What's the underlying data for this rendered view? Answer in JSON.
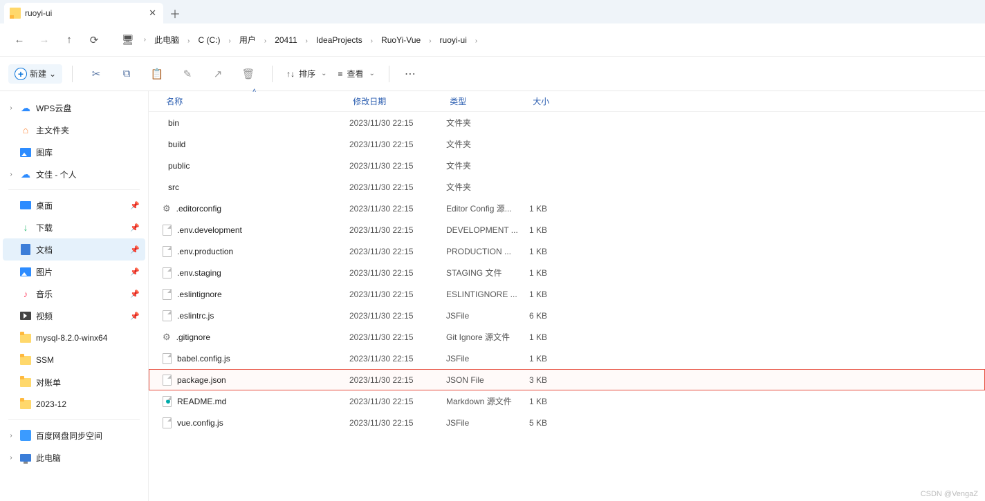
{
  "tab": {
    "title": "ruoyi-ui"
  },
  "breadcrumbs": [
    "此电脑",
    "C (C:)",
    "用户",
    "20411",
    "IdeaProjects",
    "RuoYi-Vue",
    "ruoyi-ui"
  ],
  "toolbar": {
    "new_label": "新建",
    "sort_label": "排序",
    "view_label": "查看"
  },
  "sidebar": {
    "group1": [
      {
        "label": "WPS云盘",
        "icon": "cloud",
        "exp": true
      },
      {
        "label": "主文件夹",
        "icon": "home",
        "exp": false
      },
      {
        "label": "图库",
        "icon": "pic",
        "exp": false
      },
      {
        "label": "文佳 - 个人",
        "icon": "cloud",
        "exp": true
      }
    ],
    "group2": [
      {
        "label": "桌面",
        "icon": "desk",
        "pin": true
      },
      {
        "label": "下载",
        "icon": "dl",
        "pin": true
      },
      {
        "label": "文档",
        "icon": "docs",
        "pin": true,
        "selected": true
      },
      {
        "label": "图片",
        "icon": "pic",
        "pin": true
      },
      {
        "label": "音乐",
        "icon": "music",
        "pin": true
      },
      {
        "label": "视频",
        "icon": "video",
        "pin": true
      },
      {
        "label": "mysql-8.2.0-winx64",
        "icon": "folder",
        "pin": false
      },
      {
        "label": "SSM",
        "icon": "folder",
        "pin": false
      },
      {
        "label": "对账单",
        "icon": "folder",
        "pin": false
      },
      {
        "label": "2023-12",
        "icon": "folder",
        "pin": false
      }
    ],
    "group3": [
      {
        "label": "百度网盘同步空间",
        "icon": "baidu",
        "exp": true
      },
      {
        "label": "此电脑",
        "icon": "pc",
        "exp": true
      }
    ]
  },
  "columns": {
    "name": "名称",
    "date": "修改日期",
    "type": "类型",
    "size": "大小"
  },
  "files": [
    {
      "name": "bin",
      "date": "2023/11/30 22:15",
      "type": "文件夹",
      "size": "",
      "icon": "folder"
    },
    {
      "name": "build",
      "date": "2023/11/30 22:15",
      "type": "文件夹",
      "size": "",
      "icon": "folder"
    },
    {
      "name": "public",
      "date": "2023/11/30 22:15",
      "type": "文件夹",
      "size": "",
      "icon": "folder"
    },
    {
      "name": "src",
      "date": "2023/11/30 22:15",
      "type": "文件夹",
      "size": "",
      "icon": "folder"
    },
    {
      "name": ".editorconfig",
      "date": "2023/11/30 22:15",
      "type": "Editor Config 源...",
      "size": "1 KB",
      "icon": "gear"
    },
    {
      "name": ".env.development",
      "date": "2023/11/30 22:15",
      "type": "DEVELOPMENT ...",
      "size": "1 KB",
      "icon": "doc"
    },
    {
      "name": ".env.production",
      "date": "2023/11/30 22:15",
      "type": "PRODUCTION ...",
      "size": "1 KB",
      "icon": "doc"
    },
    {
      "name": ".env.staging",
      "date": "2023/11/30 22:15",
      "type": "STAGING 文件",
      "size": "1 KB",
      "icon": "doc"
    },
    {
      "name": ".eslintignore",
      "date": "2023/11/30 22:15",
      "type": "ESLINTIGNORE ...",
      "size": "1 KB",
      "icon": "doc"
    },
    {
      "name": ".eslintrc.js",
      "date": "2023/11/30 22:15",
      "type": "JSFile",
      "size": "6 KB",
      "icon": "doc"
    },
    {
      "name": ".gitignore",
      "date": "2023/11/30 22:15",
      "type": "Git Ignore 源文件",
      "size": "1 KB",
      "icon": "gear"
    },
    {
      "name": "babel.config.js",
      "date": "2023/11/30 22:15",
      "type": "JSFile",
      "size": "1 KB",
      "icon": "doc"
    },
    {
      "name": "package.json",
      "date": "2023/11/30 22:15",
      "type": "JSON File",
      "size": "3 KB",
      "icon": "doc",
      "highlight": true
    },
    {
      "name": "README.md",
      "date": "2023/11/30 22:15",
      "type": "Markdown 源文件",
      "size": "1 KB",
      "icon": "md"
    },
    {
      "name": "vue.config.js",
      "date": "2023/11/30 22:15",
      "type": "JSFile",
      "size": "5 KB",
      "icon": "doc"
    }
  ],
  "watermark": "CSDN @VengaZ"
}
